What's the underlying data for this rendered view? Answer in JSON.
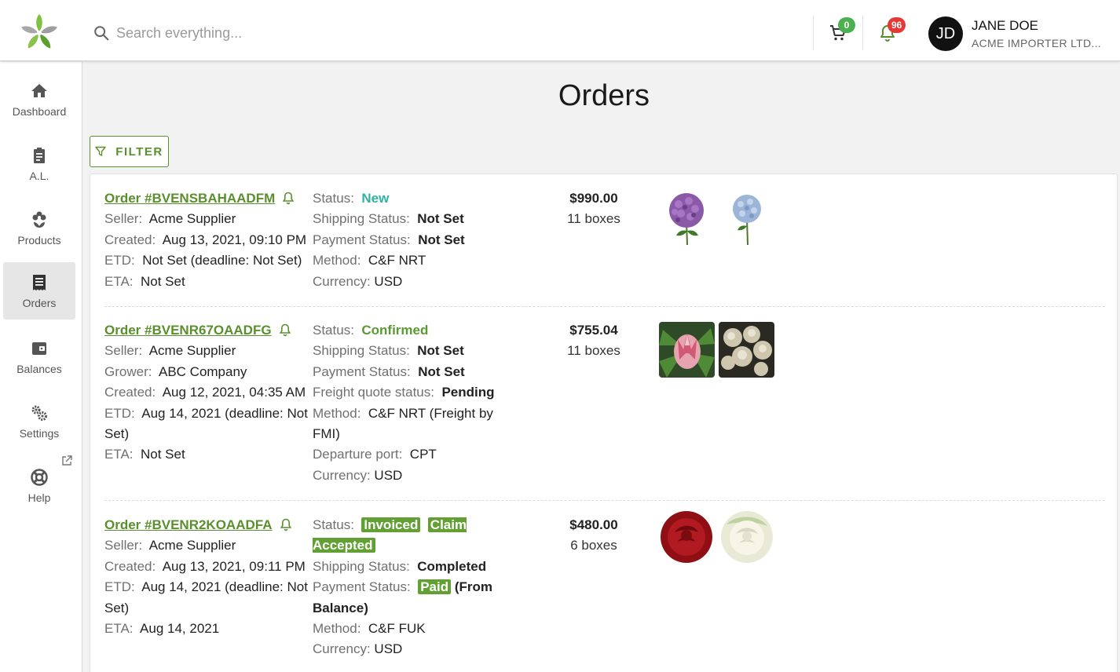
{
  "header": {
    "search_placeholder": "Search everything...",
    "cart_count": "0",
    "notification_count": "96",
    "user_initials": "JD",
    "user_name": "JANE DOE",
    "user_company": "ACME IMPORTER LTD...",
    "colors": {
      "brand_green": "#5a8f2e",
      "cart_badge": "#4caf50",
      "notif_badge": "#e53935"
    }
  },
  "sidebar": {
    "items": [
      {
        "label": "Dashboard",
        "icon": "home-icon"
      },
      {
        "label": "A.L.",
        "icon": "clipboard-icon"
      },
      {
        "label": "Products",
        "icon": "flower-icon"
      },
      {
        "label": "Orders",
        "icon": "receipt-icon",
        "active": true
      },
      {
        "label": "Balances",
        "icon": "wallet-icon"
      },
      {
        "label": "Settings",
        "icon": "gears-icon"
      },
      {
        "label": "Help",
        "icon": "lifebuoy-icon",
        "external": true
      }
    ]
  },
  "main": {
    "title": "Orders",
    "filter_label": "FILTER"
  },
  "labels": {
    "seller": "Seller:",
    "grower": "Grower:",
    "created": "Created:",
    "etd": "ETD:",
    "eta": "ETA:",
    "status": "Status:",
    "shipping_status": "Shipping Status:",
    "payment_status": "Payment Status:",
    "freight_quote_status": "Freight quote status:",
    "method": "Method:",
    "departure_port": "Departure port:",
    "currency": "Currency:"
  },
  "orders": [
    {
      "id": "Order #BVENSBAHAADFM",
      "seller": "Acme Supplier",
      "created": "Aug 13, 2021, 09:10 PM",
      "etd": "Not Set (deadline: Not Set)",
      "eta": "Not Set",
      "status": "New",
      "shipping_status": "Not Set",
      "payment_status": "Not Set",
      "method": "C&F NRT",
      "currency": "USD",
      "price": "$990.00",
      "boxes": "11 boxes",
      "images": [
        "purple-hydrangea",
        "blue-hydrangea"
      ]
    },
    {
      "id": "Order #BVENR67OAADFG",
      "seller": "Acme Supplier",
      "grower": "ABC Company",
      "created": "Aug 12, 2021, 04:35 AM",
      "etd": "Aug 14, 2021 (deadline: Not Set)",
      "eta": "Not Set",
      "status": "Confirmed",
      "shipping_status": "Not Set",
      "payment_status": "Not Set",
      "freight_quote_status": "Pending",
      "method": "C&F NRT (Freight by FMI)",
      "departure_port": "CPT",
      "currency": "USD",
      "price": "$755.04",
      "boxes": "11 boxes",
      "images": [
        "pink-protea",
        "white-protea"
      ]
    },
    {
      "id": "Order #BVENR2KOAADFA",
      "seller": "Acme Supplier",
      "created": "Aug 13, 2021, 09:11 PM",
      "etd": "Aug 14, 2021 (deadline: Not Set)",
      "eta": "Aug 14, 2021",
      "status_chips": [
        "Invoiced",
        "Claim Accepted"
      ],
      "shipping_status": "Completed",
      "payment_status_chip": "Paid",
      "payment_status_note": "(From Balance)",
      "method": "C&F FUK",
      "currency": "USD",
      "price": "$480.00",
      "boxes": "6 boxes",
      "images": [
        "red-rose",
        "white-rose"
      ]
    }
  ]
}
